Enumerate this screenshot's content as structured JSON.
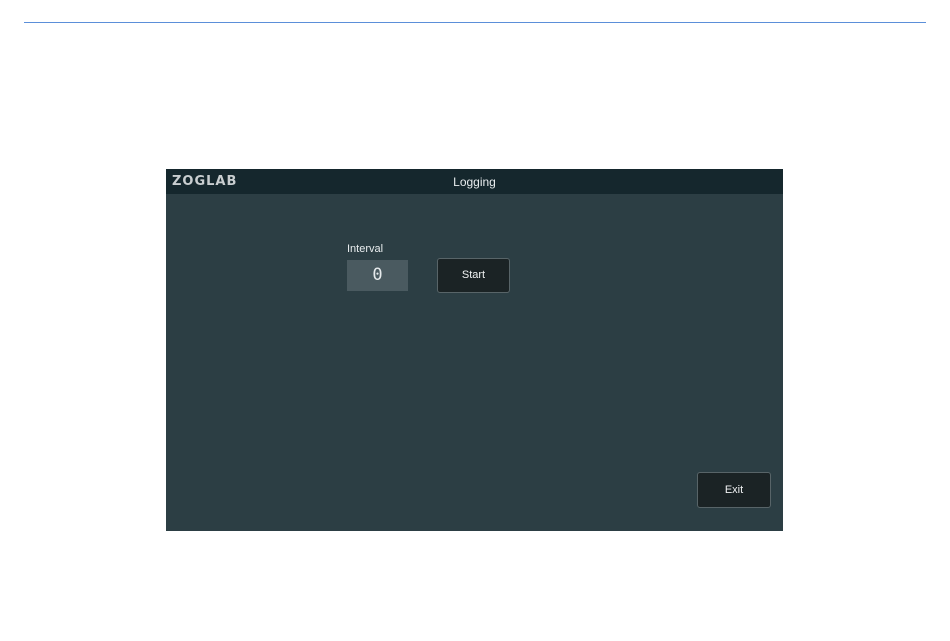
{
  "device": {
    "brand": "ZOGLAB",
    "screen_title": "Logging"
  },
  "interval": {
    "label": "Interval",
    "value": "0"
  },
  "buttons": {
    "start_label": "Start",
    "exit_label": "Exit"
  },
  "colors": {
    "panel_bg": "#2c3e44",
    "title_bar_bg": "#15272d",
    "button_bg": "#1b2325",
    "field_bg": "#4a5a60",
    "top_rule": "#5b8fd9"
  }
}
